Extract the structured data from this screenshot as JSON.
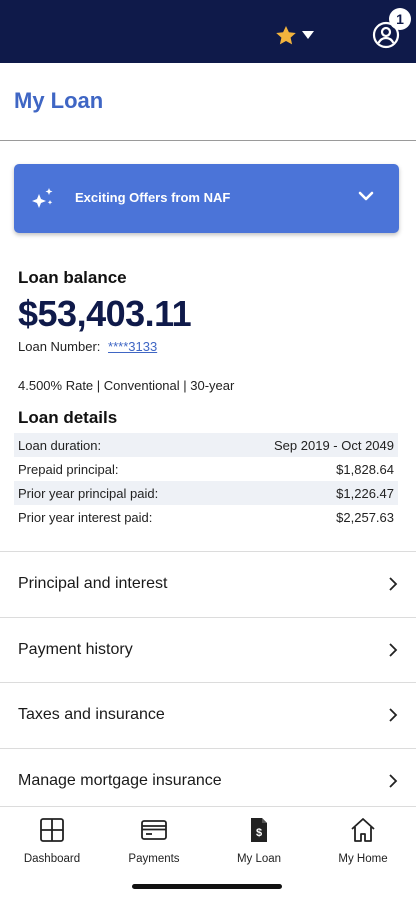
{
  "topbar": {
    "notification_count": "1"
  },
  "page": {
    "title": "My Loan"
  },
  "offers": {
    "label": "Exciting Offers from NAF"
  },
  "balance": {
    "label": "Loan balance",
    "value": "$53,403.11",
    "loan_number_label": "Loan Number:",
    "loan_number": "****3133"
  },
  "rate_line": "4.500% Rate | Conventional | 30-year",
  "details": {
    "title": "Loan details",
    "rows": [
      {
        "label": "Loan duration:",
        "value": "Sep 2019 - Oct 2049"
      },
      {
        "label": "Prepaid principal:",
        "value": "$1,828.64"
      },
      {
        "label": "Prior year principal paid:",
        "value": "$1,226.47"
      },
      {
        "label": "Prior year interest paid:",
        "value": "$2,257.63"
      }
    ]
  },
  "nav": [
    {
      "label": "Principal and interest"
    },
    {
      "label": "Payment history"
    },
    {
      "label": "Taxes and insurance"
    },
    {
      "label": "Manage mortgage insurance"
    }
  ],
  "tabs": [
    {
      "label": "Dashboard",
      "icon": "dashboard-icon"
    },
    {
      "label": "Payments",
      "icon": "card-icon"
    },
    {
      "label": "My Loan",
      "icon": "document-dollar-icon"
    },
    {
      "label": "My Home",
      "icon": "home-icon"
    }
  ],
  "colors": {
    "header_bg": "#0f1a4a",
    "accent": "#3f66c4",
    "offers_bg": "#4b74d8",
    "star": "#f2b33d"
  }
}
